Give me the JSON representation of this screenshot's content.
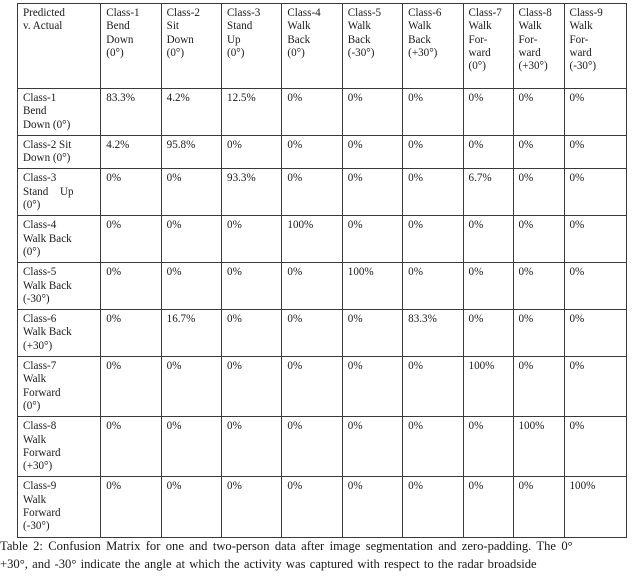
{
  "table": {
    "corner_label_lines": [
      "Predicted",
      "v. Actual"
    ],
    "columns": [
      {
        "lines": [
          "Class-1",
          "Bend",
          "Down",
          "(0°)"
        ]
      },
      {
        "lines": [
          "Class-2",
          "Sit",
          "Down",
          "(0°)"
        ]
      },
      {
        "lines": [
          "Class-3",
          "Stand",
          "Up",
          "(0°)"
        ]
      },
      {
        "lines": [
          "Class-4",
          "Walk",
          "Back",
          "(0°)"
        ]
      },
      {
        "lines": [
          "Class-5",
          "Walk",
          "Back",
          "(-30°)"
        ]
      },
      {
        "lines": [
          "Class-6",
          "Walk",
          "Back",
          "(+30°)"
        ]
      },
      {
        "lines": [
          "Class-7",
          "Walk",
          "For-",
          "ward",
          "(0°)"
        ]
      },
      {
        "lines": [
          "Class-8",
          "Walk",
          "For-",
          "ward",
          "(+30°)"
        ]
      },
      {
        "lines": [
          "Class-9",
          "Walk",
          "For-",
          "ward",
          "(-30°)"
        ]
      }
    ],
    "rows": [
      {
        "label_lines": [
          "Class-1",
          "Bend",
          "Down (0°)"
        ],
        "values": [
          "83.3%",
          "4.2%",
          "12.5%",
          "0%",
          "0%",
          "0%",
          "0%",
          "0%",
          "0%"
        ]
      },
      {
        "label_lines": [
          "Class-2 Sit",
          "Down (0°)"
        ],
        "values": [
          "4.2%",
          "95.8%",
          "0%",
          "0%",
          "0%",
          "0%",
          "0%",
          "0%",
          "0%"
        ]
      },
      {
        "label_lines": [
          "Class-3",
          "Stand Up",
          "(0°)"
        ],
        "justified_line": 1,
        "values": [
          "0%",
          "0%",
          "93.3%",
          "0%",
          "0%",
          "0%",
          "6.7%",
          "0%",
          "0%"
        ]
      },
      {
        "label_lines": [
          "Class-4",
          "Walk Back",
          "(0°)"
        ],
        "values": [
          "0%",
          "0%",
          "0%",
          "100%",
          "0%",
          "0%",
          "0%",
          "0%",
          "0%"
        ]
      },
      {
        "label_lines": [
          "Class-5",
          "Walk Back",
          "(-30°)"
        ],
        "values": [
          "0%",
          "0%",
          "0%",
          "0%",
          "100%",
          "0%",
          "0%",
          "0%",
          "0%"
        ]
      },
      {
        "label_lines": [
          "Class-6",
          "Walk Back",
          "(+30°)"
        ],
        "values": [
          "0%",
          "16.7%",
          "0%",
          "0%",
          "0%",
          "83.3%",
          "0%",
          "0%",
          "0%"
        ]
      },
      {
        "label_lines": [
          "Class-7",
          "Walk",
          "Forward",
          "(0°)"
        ],
        "values": [
          "0%",
          "0%",
          "0%",
          "0%",
          "0%",
          "0%",
          "100%",
          "0%",
          "0%"
        ]
      },
      {
        "label_lines": [
          "Class-8",
          "Walk",
          "Forward",
          "(+30°)"
        ],
        "values": [
          "0%",
          "0%",
          "0%",
          "0%",
          "0%",
          "0%",
          "0%",
          "100%",
          "0%"
        ]
      },
      {
        "label_lines": [
          "Class-9",
          "Walk",
          "Forward",
          "(-30°)"
        ],
        "values": [
          "0%",
          "0%",
          "0%",
          "0%",
          "0%",
          "0%",
          "0%",
          "0%",
          "100%"
        ]
      }
    ]
  },
  "caption": {
    "number": "Table 2:",
    "line1": "Table 2:  Confusion Matrix for one and two-person data after image segmentation and zero-padding.  The 0°",
    "line2": "+30°, and -30° indicate the angle at which the activity was captured with respect to the radar broadside"
  },
  "chart_data": {
    "type": "table",
    "title": "Confusion Matrix for one and two-person data after image segmentation and zero-padding",
    "categories": [
      "Class-1 Bend Down (0°)",
      "Class-2 Sit Down (0°)",
      "Class-3 Stand Up (0°)",
      "Class-4 Walk Back (0°)",
      "Class-5 Walk Back (-30°)",
      "Class-6 Walk Back (+30°)",
      "Class-7 Walk Forward (0°)",
      "Class-8 Walk Forward (+30°)",
      "Class-9 Walk Forward (-30°)"
    ],
    "xlabel": "Predicted",
    "ylabel": "Actual",
    "unit": "percent",
    "matrix": [
      [
        83.3,
        4.2,
        12.5,
        0,
        0,
        0,
        0,
        0,
        0
      ],
      [
        4.2,
        95.8,
        0,
        0,
        0,
        0,
        0,
        0,
        0
      ],
      [
        0,
        0,
        93.3,
        0,
        0,
        0,
        6.7,
        0,
        0
      ],
      [
        0,
        0,
        0,
        100,
        0,
        0,
        0,
        0,
        0
      ],
      [
        0,
        0,
        0,
        0,
        100,
        0,
        0,
        0,
        0
      ],
      [
        0,
        16.7,
        0,
        0,
        0,
        83.3,
        0,
        0,
        0
      ],
      [
        0,
        0,
        0,
        0,
        0,
        0,
        100,
        0,
        0
      ],
      [
        0,
        0,
        0,
        0,
        0,
        0,
        0,
        100,
        0
      ],
      [
        0,
        0,
        0,
        0,
        0,
        0,
        0,
        0,
        100
      ]
    ],
    "diagonal_accuracy": [
      83.3,
      95.8,
      93.3,
      100,
      100,
      83.3,
      100,
      100,
      100
    ]
  }
}
